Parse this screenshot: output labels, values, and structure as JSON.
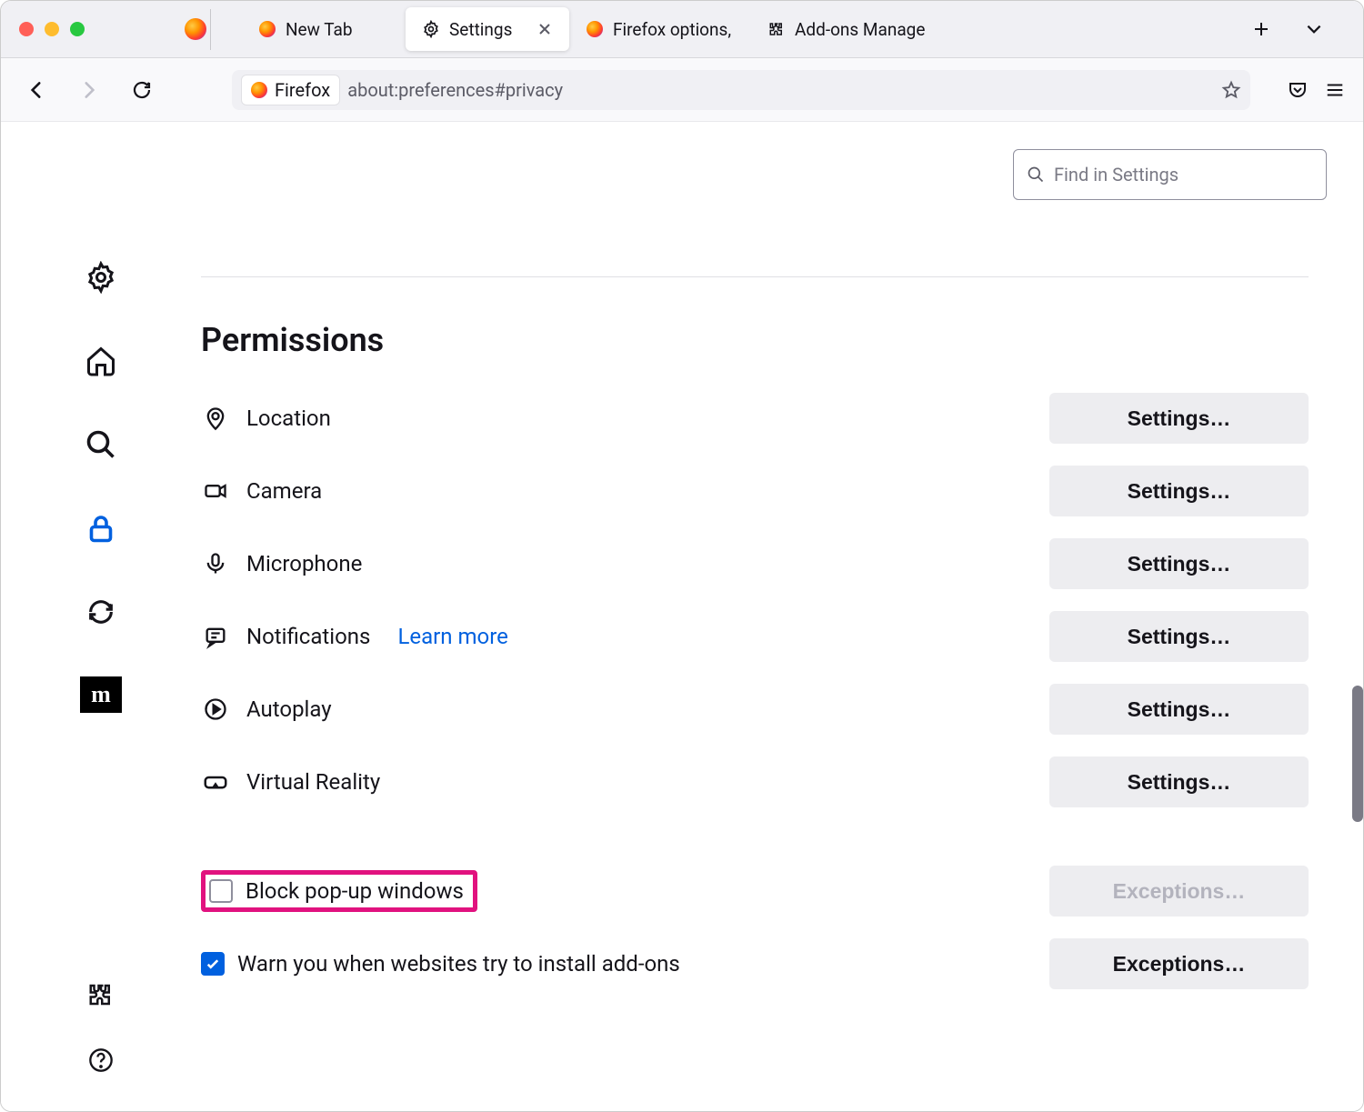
{
  "tabs": [
    {
      "label": "New Tab",
      "icon": "firefox"
    },
    {
      "label": "Settings",
      "icon": "gear",
      "active": true
    },
    {
      "label": "Firefox options,",
      "icon": "firefox"
    },
    {
      "label": "Add-ons Manage",
      "icon": "puzzle"
    }
  ],
  "urlbar": {
    "identity_label": "Firefox",
    "url": "about:preferences#privacy"
  },
  "search": {
    "placeholder": "Find in Settings"
  },
  "heading": "Permissions",
  "permissions": [
    {
      "key": "location",
      "label": "Location",
      "button": "Settings…"
    },
    {
      "key": "camera",
      "label": "Camera",
      "button": "Settings…"
    },
    {
      "key": "microphone",
      "label": "Microphone",
      "button": "Settings…"
    },
    {
      "key": "notifications",
      "label": "Notifications",
      "button": "Settings…",
      "learn_more": "Learn more"
    },
    {
      "key": "autoplay",
      "label": "Autoplay",
      "button": "Settings…"
    },
    {
      "key": "vr",
      "label": "Virtual Reality",
      "button": "Settings…"
    }
  ],
  "checkboxes": {
    "block_popups": {
      "label": "Block pop-up windows",
      "checked": false,
      "button": "Exceptions…",
      "button_disabled": true
    },
    "warn_addons": {
      "label": "Warn you when websites try to install add-ons",
      "checked": true,
      "button": "Exceptions…",
      "button_disabled": false
    }
  },
  "mozilla_logo": "m"
}
